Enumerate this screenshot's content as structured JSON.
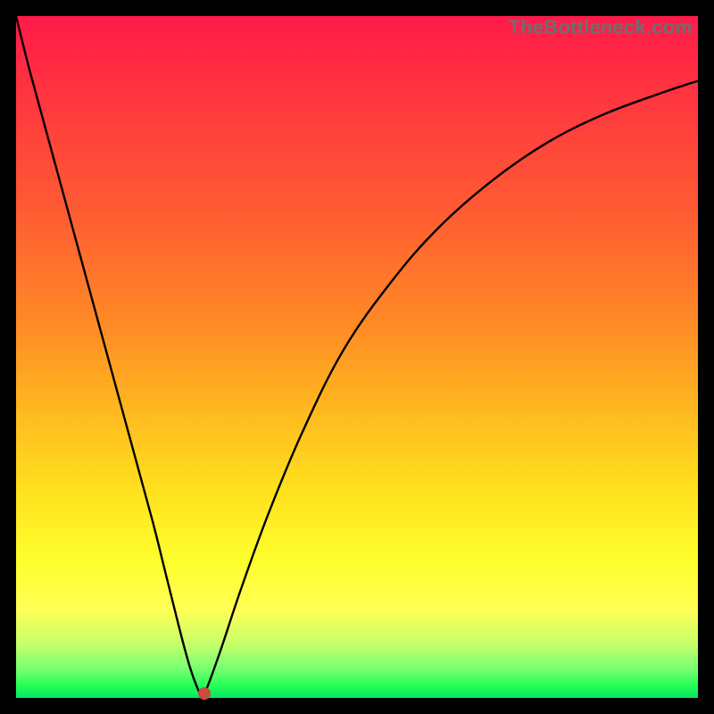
{
  "watermark": "TheBottleneck.com",
  "chart_data": {
    "type": "line",
    "title": "",
    "xlabel": "",
    "ylabel": "",
    "xlim": [
      0,
      100
    ],
    "ylim": [
      0,
      100
    ],
    "grid": false,
    "series": [
      {
        "name": "curve",
        "x": [
          0,
          2,
          5,
          8,
          11,
          14,
          17,
          20,
          22,
          24,
          25.5,
          26.8,
          27.3,
          28,
          30,
          33,
          37,
          42,
          48,
          55,
          62,
          70,
          78,
          86,
          94,
          100
        ],
        "y": [
          100,
          92,
          81,
          70,
          59,
          48,
          37,
          26,
          18,
          10,
          4.5,
          1.0,
          0.5,
          1.5,
          7,
          16,
          27,
          39,
          51,
          61,
          69,
          76,
          81.5,
          85.5,
          88.5,
          90.5
        ]
      }
    ],
    "marker": {
      "x": 27.6,
      "y": 0.6
    },
    "gradient_stops": [
      {
        "pct": 0,
        "color": "#ff1a4a"
      },
      {
        "pct": 45,
        "color": "#ff8a26"
      },
      {
        "pct": 80,
        "color": "#ffff2e"
      },
      {
        "pct": 100,
        "color": "#03e860"
      }
    ]
  }
}
